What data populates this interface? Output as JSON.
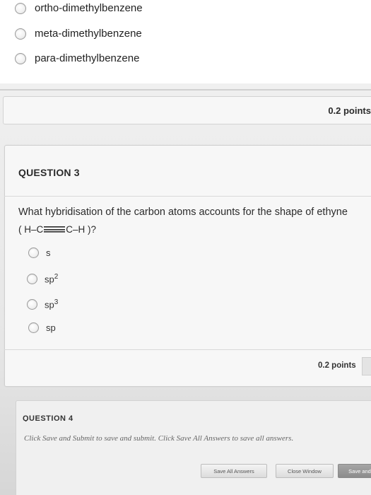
{
  "previous_question": {
    "options": [
      "ortho-dimethylbenzene",
      "meta-dimethylbenzene",
      "para-dimethylbenzene"
    ],
    "points": "0.2 points"
  },
  "question3": {
    "title": "QUESTION 3",
    "prompt": "What hybridisation of the carbon atoms accounts for the shape of ethyne",
    "formula": {
      "left": "( H–C",
      "right": "C–H )?"
    },
    "options": [
      {
        "base": "s",
        "sup": ""
      },
      {
        "base": "sp",
        "sup": "2"
      },
      {
        "base": "sp",
        "sup": "3"
      },
      {
        "base": "sp",
        "sup": ""
      }
    ],
    "points": "0.2 points"
  },
  "question4": {
    "title": "QUESTION 4",
    "note": "Click Save and Submit to save and submit. Click Save All Answers to save all answers.",
    "buttons": {
      "save_all": "Save All Answers",
      "close": "Close Window",
      "save_submit": "Save and"
    }
  }
}
